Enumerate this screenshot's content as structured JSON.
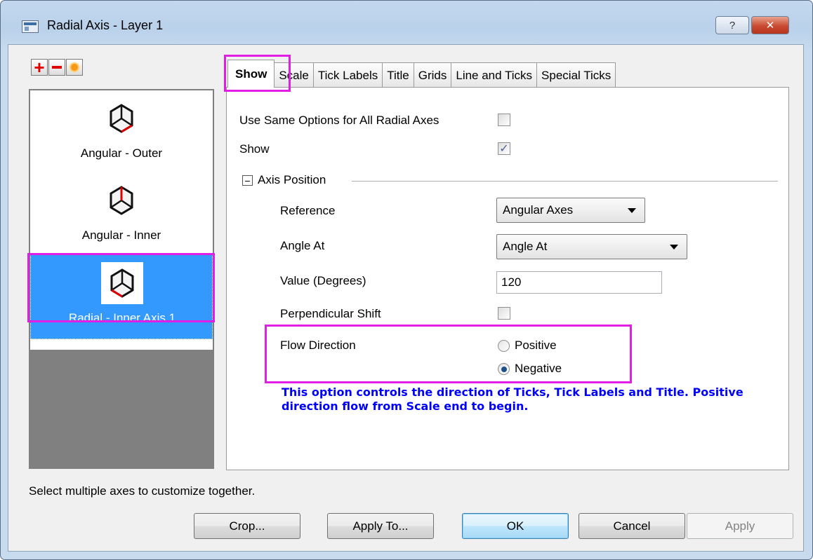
{
  "window": {
    "title": "Radial Axis - Layer 1",
    "help_label": "?",
    "close_label": "✕"
  },
  "toolbar": {
    "add_icon": "plus-icon",
    "remove_icon": "minus-icon",
    "reset_icon": "orange-circle-icon"
  },
  "axes": [
    {
      "label": "Angular - Outer",
      "selected": false
    },
    {
      "label": "Angular - Inner",
      "selected": false
    },
    {
      "label": "Radial - Inner Axis 1",
      "selected": true
    }
  ],
  "tabs": [
    {
      "label": "Show",
      "active": true
    },
    {
      "label": "Scale",
      "active": false
    },
    {
      "label": "Tick Labels",
      "active": false
    },
    {
      "label": "Title",
      "active": false
    },
    {
      "label": "Grids",
      "active": false
    },
    {
      "label": "Line and Ticks",
      "active": false
    },
    {
      "label": "Special Ticks",
      "active": false
    }
  ],
  "show_tab": {
    "same_options_label": "Use Same Options for All Radial Axes",
    "same_options_checked": false,
    "show_label": "Show",
    "show_checked": true,
    "group_toggle": "−",
    "group_label": "Axis Position",
    "reference_label": "Reference",
    "reference_value": "Angular Axes",
    "angle_at_label": "Angle At",
    "angle_at_value": "Angle At",
    "value_label": "Value (Degrees)",
    "value_value": "120",
    "perp_shift_label": "Perpendicular Shift",
    "perp_shift_checked": false,
    "flow_label": "Flow Direction",
    "flow_options": [
      {
        "label": "Positive",
        "selected": false
      },
      {
        "label": "Negative",
        "selected": true
      }
    ],
    "note": "This option controls the direction of Ticks, Tick Labels and Title. Positive direction flow from Scale end to begin."
  },
  "hint": "Select multiple axes to customize together.",
  "buttons": {
    "crop": "Crop...",
    "apply_to": "Apply To...",
    "ok": "OK",
    "cancel": "Cancel",
    "apply": "Apply"
  },
  "colors": {
    "highlight": "#e11ee3",
    "selection": "#3399ff",
    "note_text": "#0000ff"
  }
}
